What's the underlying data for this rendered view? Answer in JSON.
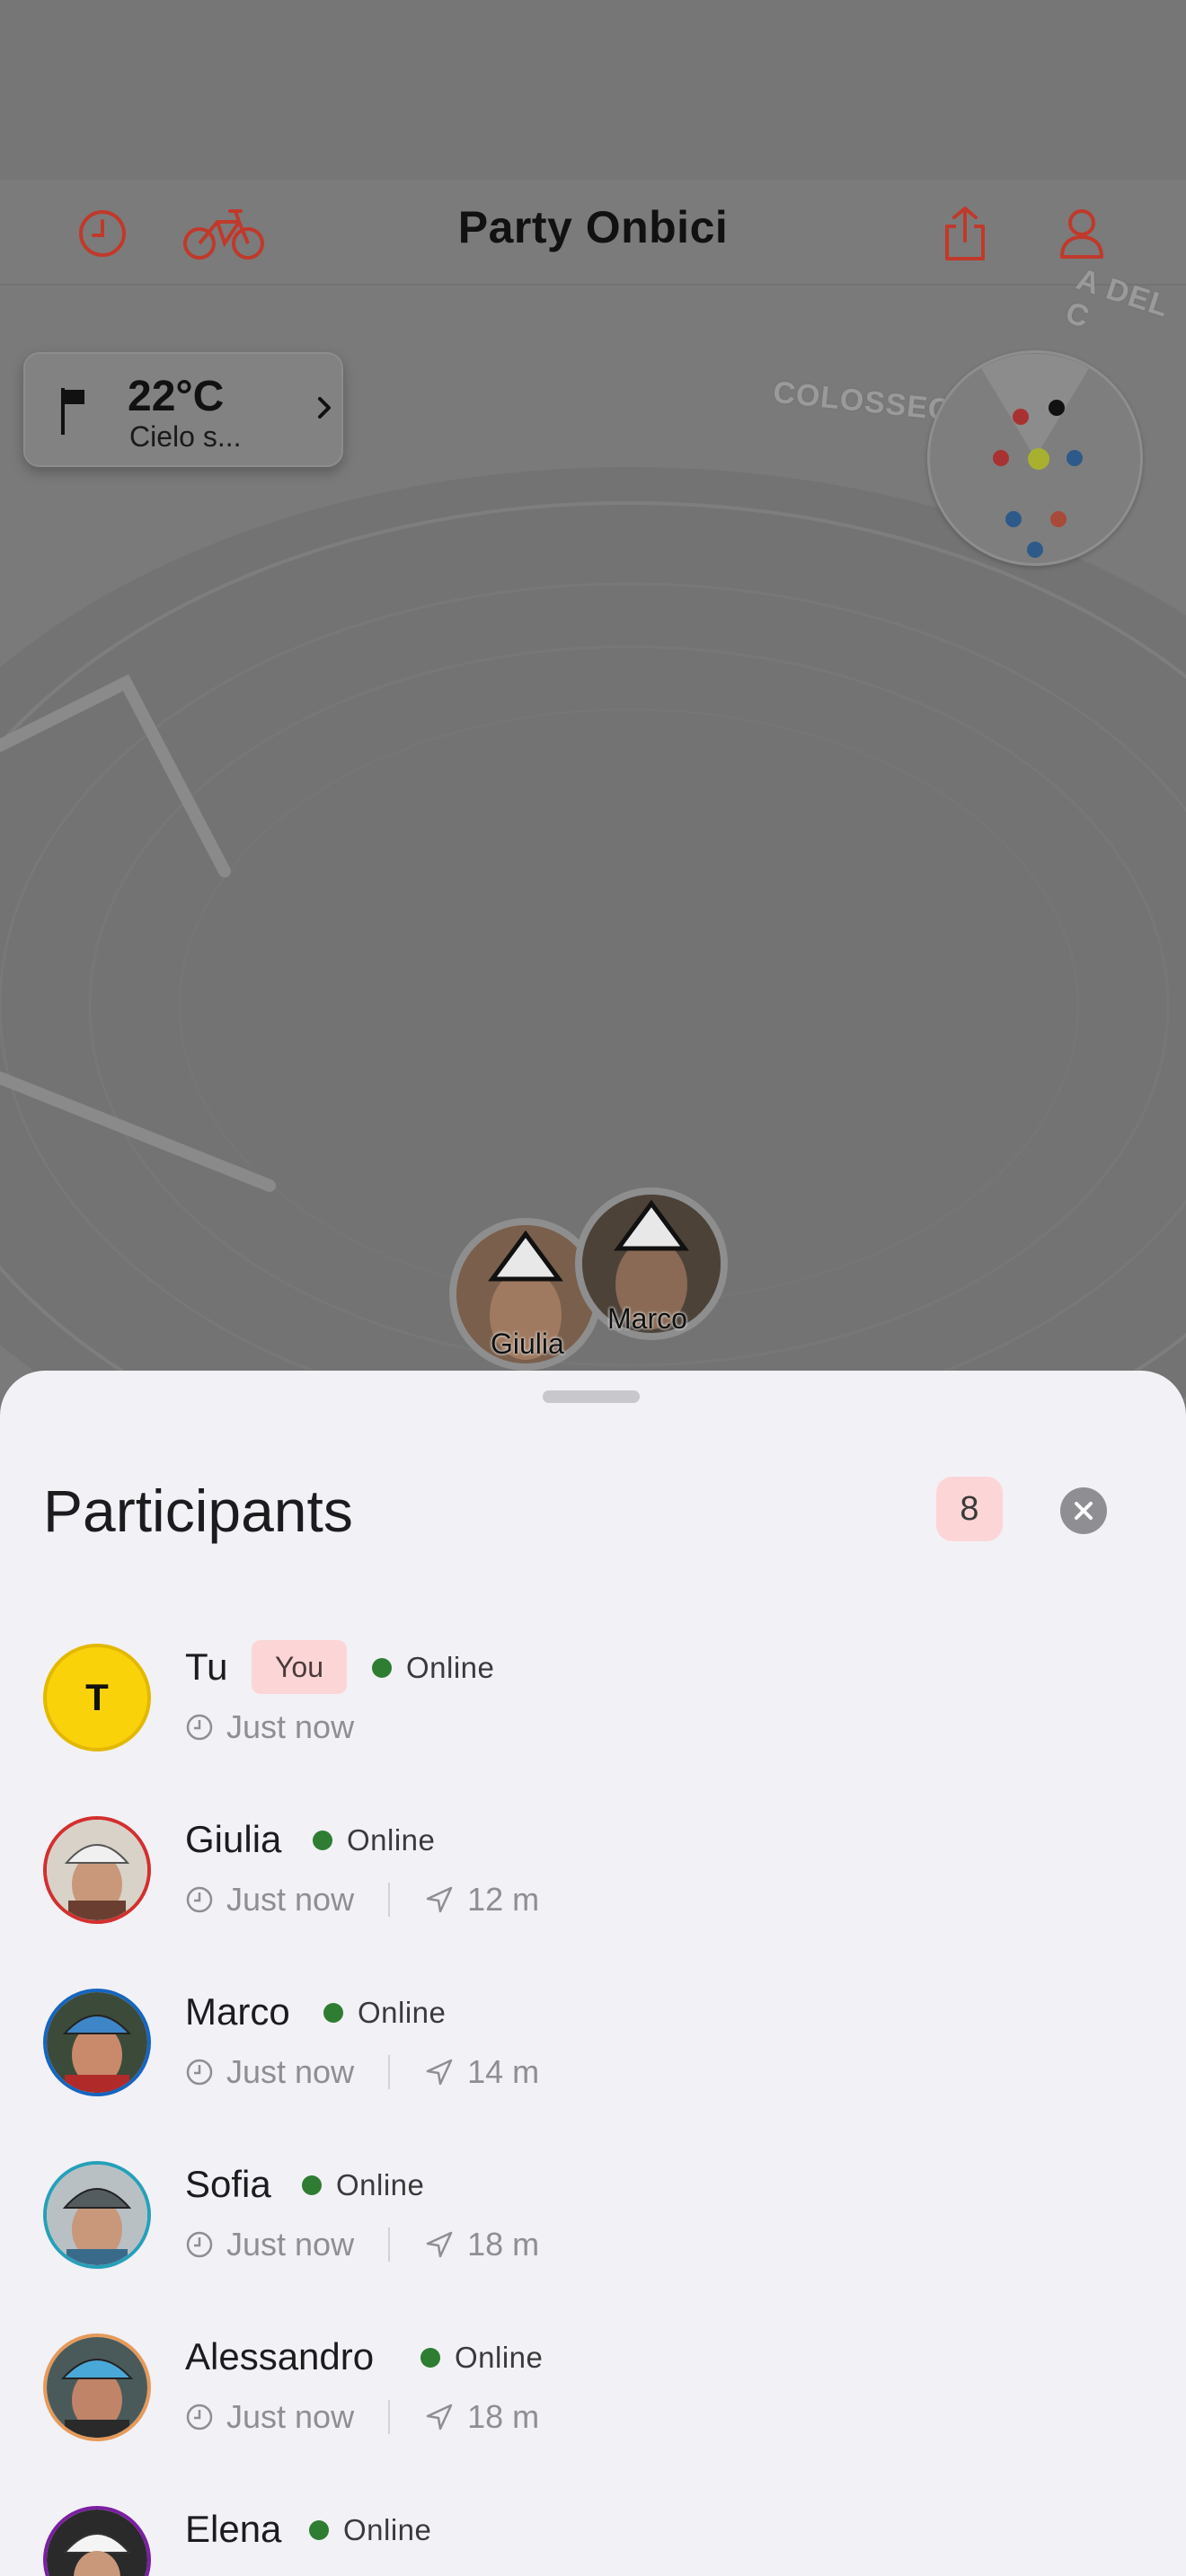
{
  "app": {
    "title": "Party Onbici",
    "accent_color": "#c0392b",
    "toolbar_icons": [
      "history-icon",
      "bicycle-icon",
      "share-icon",
      "profile-icon"
    ]
  },
  "weather": {
    "temperature": "22°C",
    "condition": "Cielo s...",
    "icon": "flag-icon"
  },
  "map": {
    "labels": [
      "COLOSSEO",
      "A DEL C"
    ],
    "pins": [
      {
        "name": "Giulia"
      },
      {
        "name": "Marco"
      }
    ]
  },
  "sheet": {
    "title": "Participants",
    "count": "8",
    "participants": [
      {
        "name": "Tu",
        "initial": "T",
        "badge": "You",
        "status": "Online",
        "last_seen": "Just now",
        "distance": ""
      },
      {
        "name": "Giulia",
        "status": "Online",
        "last_seen": "Just now",
        "distance": "12 m",
        "ring_color": "#d32f2f"
      },
      {
        "name": "Marco",
        "status": "Online",
        "last_seen": "Just now",
        "distance": "14 m",
        "ring_color": "#1565c0"
      },
      {
        "name": "Sofia",
        "status": "Online",
        "last_seen": "Just now",
        "distance": "18 m",
        "ring_color": "#26a0b8"
      },
      {
        "name": "Alessandro",
        "status": "Online",
        "last_seen": "Just now",
        "distance": "18 m",
        "ring_color": "#e69a5a"
      },
      {
        "name": "Elena",
        "status": "Online",
        "last_seen": "",
        "distance": "",
        "ring_color": "#7b1fa2"
      }
    ]
  }
}
